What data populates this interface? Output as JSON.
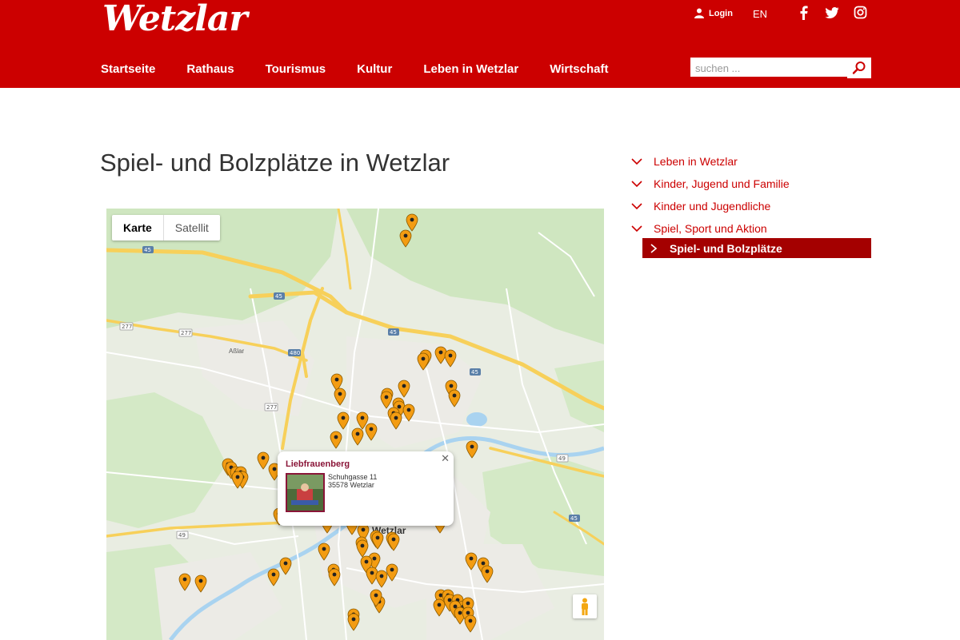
{
  "header": {
    "logo_text": "Wetzlar",
    "login_label": "Login",
    "lang_label": "EN",
    "social": [
      "facebook-icon",
      "twitter-icon",
      "instagram-icon"
    ],
    "nav": [
      "Startseite",
      "Rathaus",
      "Tourismus",
      "Kultur",
      "Leben in Wetzlar",
      "Wirtschaft"
    ],
    "search_placeholder": "suchen ..."
  },
  "main": {
    "title": "Spiel- und Bolzplätze in Wetzlar",
    "map": {
      "type_active": "Karte",
      "type_other": "Satellit",
      "city_label": "Wetzlar",
      "place_label": "Aßlar",
      "road_labels": [
        "45",
        "45",
        "277",
        "277",
        "480",
        "45",
        "45",
        "49",
        "49",
        "45"
      ],
      "popup": {
        "title": "Liebfrauenberg",
        "street": "Schuhgasse 11",
        "city": "35578 Wetzlar"
      }
    }
  },
  "sidebar": {
    "breadcrumbs": [
      "Leben in Wetzlar",
      "Kinder, Jugend und Familie",
      "Kinder und Jugendliche",
      "Spiel, Sport und Aktion"
    ],
    "active": "Spiel- und Bolzplätze"
  },
  "colors": {
    "brand_red": "#cc0000",
    "active_red": "#a40000",
    "marker": "#f39c12"
  }
}
